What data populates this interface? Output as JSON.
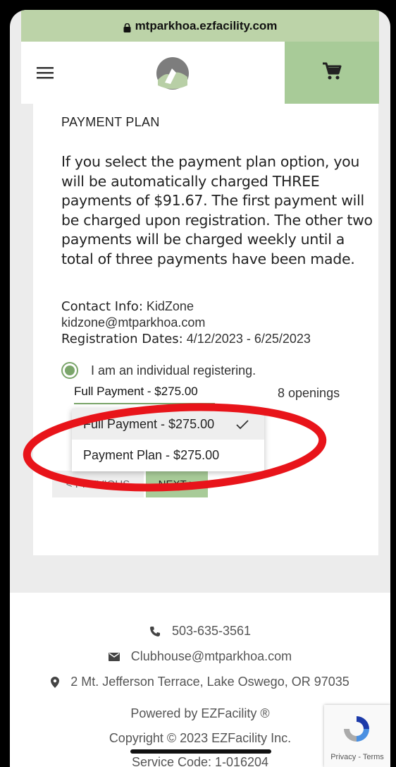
{
  "browser": {
    "url": "mtparkhoa.ezfacility.com"
  },
  "header": {
    "menu_icon": "hamburger-menu-icon",
    "cart_icon": "shopping-cart-icon",
    "accent": "#a8cb98"
  },
  "card": {
    "section_title": "PAYMENT PLAN",
    "description": "If you select the payment plan option, you will be automatically charged THREE payments of $91.67. The first payment will be charged upon registration. The other two payments will be charged weekly until a total of three payments have been made.",
    "contact_label": "Contact Info:",
    "contact_name": "KidZone",
    "contact_email": "kidzone@mtparkhoa.com",
    "dates_label": "Registration Dates:",
    "dates_value": "4/12/2023 - 6/25/2023",
    "radio_label": "I am an individual registering.",
    "selected_option": "Full Payment - $275.00",
    "openings": "8 openings",
    "dropdown_options": [
      "Full Payment - $275.00",
      "Payment Plan - $275.00"
    ],
    "prev_label": "< PREVIOUS",
    "next_label": "NEXT >"
  },
  "footer": {
    "phone": "503-635-3561",
    "email": "Clubhouse@mtparkhoa.com",
    "address": "2 Mt. Jefferson Terrace, Lake Oswego, OR 97035",
    "powered_by": "Powered by EZFacility ®",
    "copyright": "Copyright © 2023 EZFacility Inc.",
    "service_code": "Service Code: 1-016204",
    "recaptcha_terms": "Privacy - Terms"
  },
  "annotation_color": "#e8141a"
}
